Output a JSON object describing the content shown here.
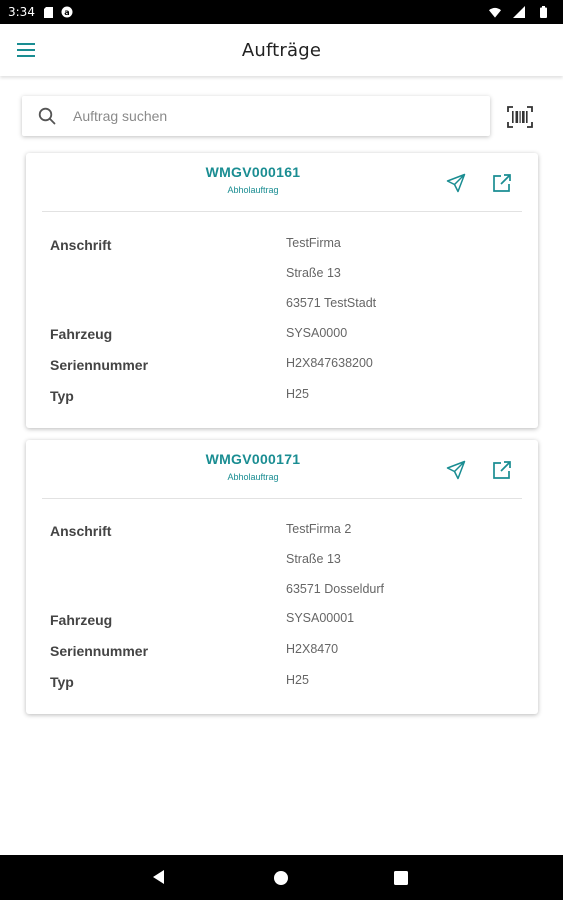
{
  "status_bar": {
    "time": "3:34"
  },
  "app_bar": {
    "title": "Aufträge"
  },
  "search": {
    "placeholder": "Auftrag suchen"
  },
  "colors": {
    "accent": "#1a8d92"
  },
  "orders": [
    {
      "number": "WMGV000161",
      "type": "Abholauftrag",
      "fields": {
        "anschrift_label": "Anschrift",
        "anschrift": [
          "TestFirma",
          "Straße 13",
          "63571 TestStadt"
        ],
        "fahrzeug_label": "Fahrzeug",
        "fahrzeug": "SYSA0000",
        "seriennummer_label": "Seriennummer",
        "seriennummer": "H2X847638200",
        "typ_label": "Typ",
        "typ": "H25"
      }
    },
    {
      "number": "WMGV000171",
      "type": "Abholauftrag",
      "fields": {
        "anschrift_label": "Anschrift",
        "anschrift": [
          "TestFirma 2",
          "Straße 13",
          "63571 Dosseldurf"
        ],
        "fahrzeug_label": "Fahrzeug",
        "fahrzeug": "SYSA00001",
        "seriennummer_label": "Seriennummer",
        "seriennummer": "H2X8470",
        "typ_label": "Typ",
        "typ": "H25"
      }
    }
  ],
  "icons": {
    "menu": "menu-icon",
    "search": "search-icon",
    "barcode": "barcode-icon",
    "send": "send-icon",
    "open": "open-external-icon"
  }
}
